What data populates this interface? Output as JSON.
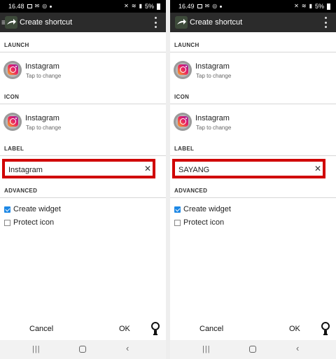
{
  "panels": [
    {
      "status": {
        "time": "16.48"
      },
      "title": "Create shortcut",
      "sections": {
        "launch": "LAUNCH",
        "icon": "ICON",
        "label": "LABEL",
        "advanced": "ADVANCED"
      },
      "launch": {
        "name": "Instagram",
        "sub": "Tap to change"
      },
      "icon": {
        "name": "Instagram",
        "sub": "Tap to change"
      },
      "label_value": "Instagram",
      "options": {
        "create_widget": "Create widget",
        "protect_icon": "Protect icon"
      },
      "buttons": {
        "cancel": "Cancel",
        "ok": "OK"
      }
    },
    {
      "status": {
        "time": "16.49"
      },
      "title": "Create shortcut",
      "sections": {
        "launch": "LAUNCH",
        "icon": "ICON",
        "label": "LABEL",
        "advanced": "ADVANCED"
      },
      "launch": {
        "name": "Instagram",
        "sub": "Tap to change"
      },
      "icon": {
        "name": "Instagram",
        "sub": "Tap to change"
      },
      "label_value": "SAYANG",
      "options": {
        "create_widget": "Create widget",
        "protect_icon": "Protect icon"
      },
      "buttons": {
        "cancel": "Cancel",
        "ok": "OK"
      }
    }
  ],
  "status_battery": "5%",
  "status_battery_2": "5%",
  "highlight_color": "#d00000",
  "accent_color": "#1e88e5",
  "icons": [
    "menu-icon",
    "app-shortcut-icon",
    "overflow-menu-icon",
    "instagram-icon",
    "clear-icon",
    "checkbox-checked-icon",
    "checkbox-unchecked-icon",
    "lightbulb-icon",
    "recents-icon",
    "home-icon",
    "back-icon"
  ],
  "checkbox_state": {
    "create_widget": true,
    "protect_icon": false
  }
}
